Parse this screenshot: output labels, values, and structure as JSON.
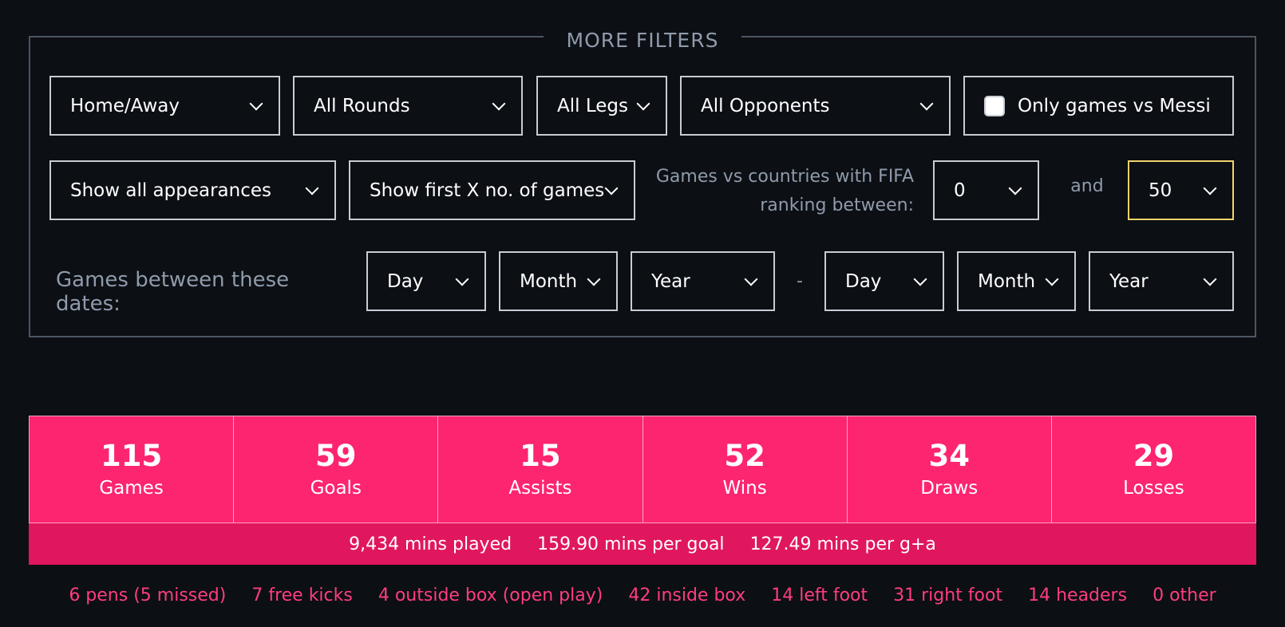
{
  "filters": {
    "legend": "MORE FILTERS",
    "home_away": "Home/Away",
    "rounds": "All Rounds",
    "legs": "All Legs",
    "opponents": "All Opponents",
    "messi_checkbox_label": "Only games vs Messi",
    "messi_checked": false,
    "appearances": "Show all appearances",
    "first_x": "Show first X no. of games",
    "fifa_label_line1": "Games vs countries with FIFA",
    "fifa_label_line2": "ranking between:",
    "fifa_min": "0",
    "fifa_and": "and",
    "fifa_max": "50",
    "dates_label": "Games between these dates:",
    "from_day": "Day",
    "from_month": "Month",
    "from_year": "Year",
    "date_separator": "-",
    "to_day": "Day",
    "to_month": "Month",
    "to_year": "Year"
  },
  "stats": [
    {
      "value": "115",
      "label": "Games"
    },
    {
      "value": "59",
      "label": "Goals"
    },
    {
      "value": "15",
      "label": "Assists"
    },
    {
      "value": "52",
      "label": "Wins"
    },
    {
      "value": "34",
      "label": "Draws"
    },
    {
      "value": "29",
      "label": "Losses"
    }
  ],
  "summary": {
    "mins_played": "9,434 mins played",
    "mins_per_goal": "159.90 mins per goal",
    "mins_per_ga": "127.49 mins per g+a"
  },
  "breakdown": [
    "6 pens (5 missed)",
    "7 free kicks",
    "4 outside box (open play)",
    "42 inside box",
    "14 left foot",
    "31 right foot",
    "14 headers",
    "0 other"
  ],
  "colors": {
    "background": "#0c0f14",
    "accent_pink": "#fd2470",
    "highlight_border": "#f2d36b"
  }
}
